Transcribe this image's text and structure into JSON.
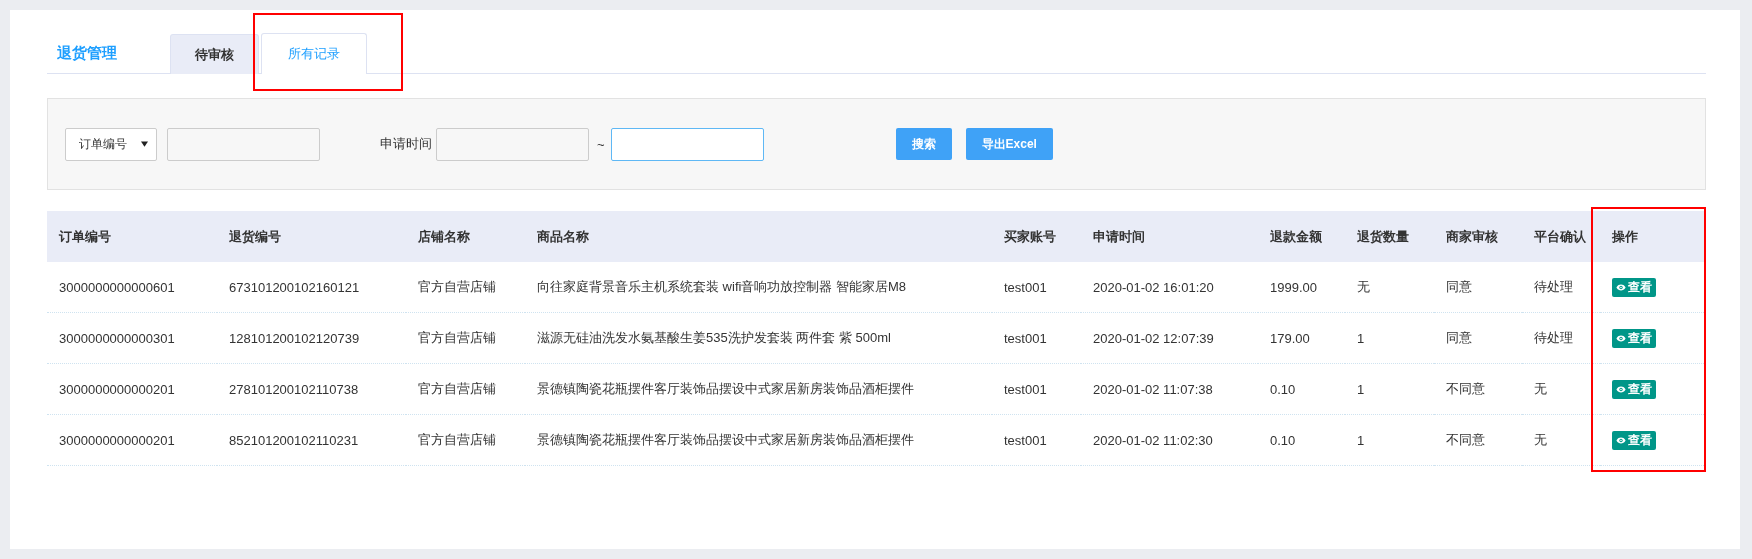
{
  "page_title": "退货管理",
  "tabs": [
    {
      "label": "待审核",
      "selected": false
    },
    {
      "label": "所有记录",
      "selected": true,
      "highlighted": true
    }
  ],
  "filters": {
    "field_select": "订单编号",
    "date_label": "申请时间",
    "range_sep": "~",
    "date_to": {
      "focused": true
    },
    "buttons": [
      "搜索",
      "导出Excel"
    ]
  },
  "table": {
    "last_column_highlighted": true,
    "columns": [
      "订单编号",
      "退货编号",
      "店铺名称",
      "商品名称",
      "买家账号",
      "申请时间",
      "退款金额",
      "退货数量",
      "商家审核",
      "平台确认",
      "操作"
    ],
    "rows": [
      {
        "cells": [
          "3000000000000601",
          "673101200102160121",
          "官方自营店铺",
          "向往家庭背景音乐主机系统套装 wifi音响功放控制器 智能家居M8",
          "test001",
          "2020-01-02 16:01:20",
          "1999.00",
          "无",
          "同意",
          "待处理"
        ],
        "action": "查看"
      },
      {
        "cells": [
          "3000000000000301",
          "128101200102120739",
          "官方自营店铺",
          "滋源无硅油洗发水氨基酸生姜535洗护发套装 两件套 紫 500ml",
          "test001",
          "2020-01-02 12:07:39",
          "179.00",
          "1",
          "同意",
          "待处理"
        ],
        "action": "查看"
      },
      {
        "cells": [
          "3000000000000201",
          "278101200102110738",
          "官方自营店铺",
          "景德镇陶瓷花瓶摆件客厅装饰品摆设中式家居新房装饰品酒柜摆件",
          "test001",
          "2020-01-02 11:07:38",
          "0.10",
          "1",
          "不同意",
          "无"
        ],
        "action": "查看"
      },
      {
        "cells": [
          "3000000000000201",
          "852101200102110231",
          "官方自营店铺",
          "景德镇陶瓷花瓶摆件客厅装饰品摆设中式家居新房装饰品酒柜摆件",
          "test001",
          "2020-01-02 11:02:30",
          "0.10",
          "1",
          "不同意",
          "无"
        ],
        "action": "查看"
      }
    ]
  }
}
